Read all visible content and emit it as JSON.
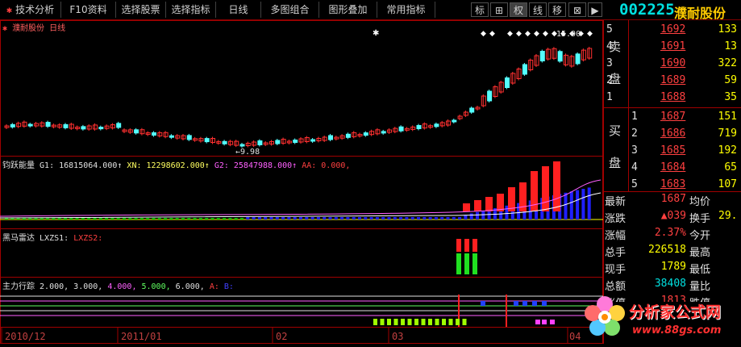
{
  "toolbar": {
    "menu_items": [
      {
        "label": "技术分析",
        "icon": "star-icon"
      },
      {
        "label": "F10资料"
      },
      {
        "label": "选择股票"
      },
      {
        "label": "选择指标"
      },
      {
        "label": "日线"
      },
      {
        "label": "多图组合"
      },
      {
        "label": "图形叠加"
      },
      {
        "label": "常用指标"
      }
    ],
    "icon_buttons": [
      {
        "label": "标",
        "name": "mark-icon"
      },
      {
        "label": "⊞",
        "name": "grid-icon"
      },
      {
        "label": "权",
        "name": "rights-icon"
      },
      {
        "label": "线",
        "name": "line-icon"
      },
      {
        "label": "移",
        "name": "move-icon"
      },
      {
        "label": "⊠",
        "name": "close-box-icon"
      },
      {
        "label": "▶",
        "name": "play-icon"
      }
    ],
    "stock_code": "002225",
    "stock_name": "濮耐股份"
  },
  "main_chart": {
    "stock_label": "濮耐股份",
    "period_label": "日线",
    "low_annotation": "←9.98",
    "high_annotation": "15.00"
  },
  "indicators": {
    "energy": {
      "title": "钧跃能量",
      "g1": "G1: 16815064.000↑",
      "xn": "XN: 12298602.000↑",
      "g2": "G2: 25847988.000↑",
      "aa": "AA: 0.000,"
    },
    "horse": {
      "title": "黑马雷达",
      "lx1": "LXZS1:",
      "lx2": "LXZS2:"
    },
    "main_force": {
      "title": "主力行踪",
      "params": "2.000, 3.000,",
      "p4": "4.000,",
      "p5": "5.000,",
      "p6": "6.000,",
      "a": "A:",
      "b": "B:"
    }
  },
  "date_axis": [
    "2010/12",
    "2011/01",
    "02",
    "03",
    "04"
  ],
  "order_book": {
    "sell_label_1": "卖",
    "sell_label_2": "盘",
    "buy_label_1": "买",
    "buy_label_2": "盘",
    "sell": [
      {
        "level": "5",
        "price": "1692",
        "vol": "133"
      },
      {
        "level": "4",
        "price": "1691",
        "vol": "13"
      },
      {
        "level": "3",
        "price": "1690",
        "vol": "322"
      },
      {
        "level": "2",
        "price": "1689",
        "vol": "59"
      },
      {
        "level": "1",
        "price": "1688",
        "vol": "35"
      }
    ],
    "buy": [
      {
        "level": "1",
        "price": "1687",
        "vol": "151"
      },
      {
        "level": "2",
        "price": "1686",
        "vol": "719"
      },
      {
        "level": "3",
        "price": "1685",
        "vol": "192"
      },
      {
        "level": "4",
        "price": "1684",
        "vol": "65"
      },
      {
        "level": "5",
        "price": "1683",
        "vol": "107"
      }
    ]
  },
  "stats": {
    "latest_label": "最新",
    "latest_value": "1687",
    "avg_label": "均价",
    "change_label": "涨跌",
    "change_value": "▲039",
    "turnover_label": "换手",
    "turnover_value": "29.",
    "pct_label": "涨幅",
    "pct_value": "2.37%",
    "open_label": "今开",
    "total_label": "总手",
    "total_value": "226518",
    "high_label": "最高",
    "cur_label": "现手",
    "cur_value": "1789",
    "low_label": "最低",
    "amount_label": "总额",
    "amount_value": "38408",
    "ratio_label": "量比",
    "limit_label": "涨停",
    "limit_value": "1813",
    "limitdown_label": "跌停"
  },
  "watermark": {
    "name": "分析家公式网",
    "url": "www.88gs.com"
  },
  "colors": {
    "up": "#ff3030",
    "down": "#54ffff",
    "grid": "#a00000",
    "yellow": "#ffff00"
  }
}
